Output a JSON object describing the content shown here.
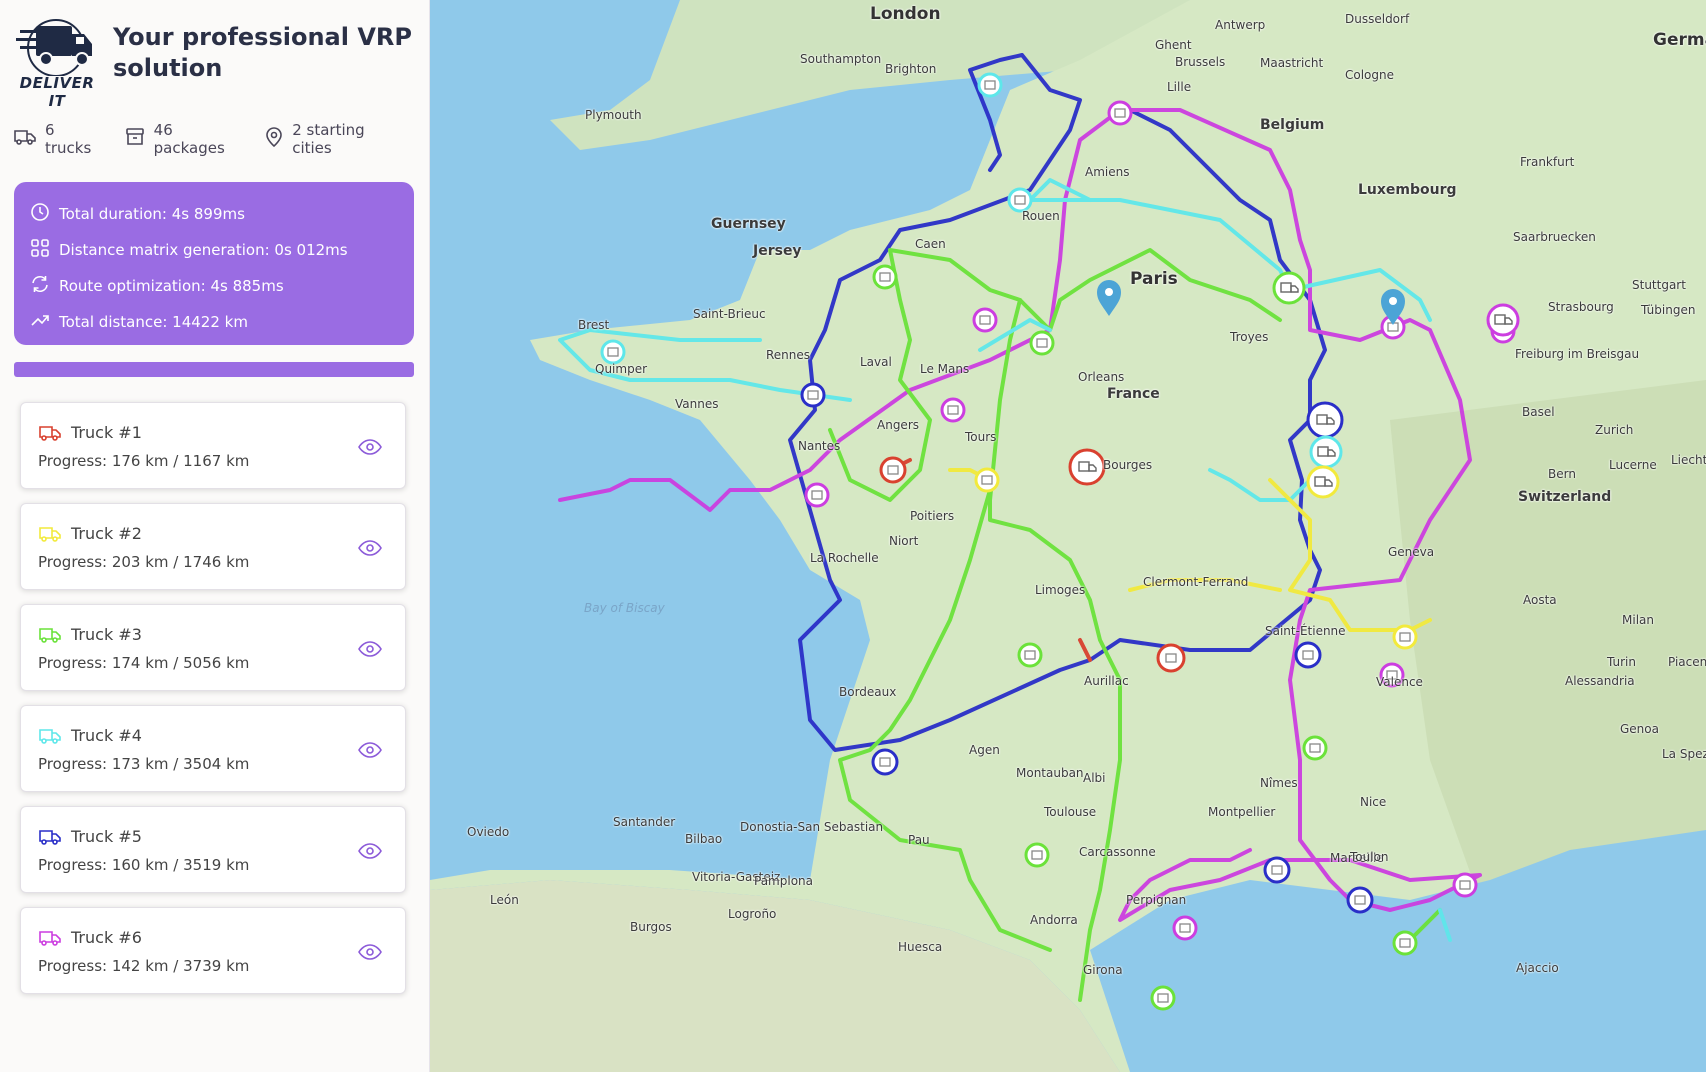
{
  "app": {
    "logo_text": "DELIVER IT",
    "tagline": "Your professional VRP solution"
  },
  "summary": {
    "trucks": "6 trucks",
    "packages": "46 packages",
    "starting_cities": "2 starting cities"
  },
  "metrics": {
    "total_duration": "Total duration: 4s 899ms",
    "matrix_generation": "Distance matrix generation: 0s 012ms",
    "route_optimization": "Route optimization: 4s 885ms",
    "total_distance": "Total distance: 14422 km"
  },
  "colors": {
    "accent": "#9a6ce3",
    "truck_1": "#d9412f",
    "truck_2": "#f2ea3c",
    "truck_3": "#6be23a",
    "truck_4": "#5ee7ea",
    "truck_5": "#2a2fc8",
    "truck_6": "#cc3ee0"
  },
  "trucks": [
    {
      "name": "Truck #1",
      "progress": "Progress: 176 km / 1167 km",
      "icon": "truck-icon",
      "color": "#d9412f"
    },
    {
      "name": "Truck #2",
      "progress": "Progress: 203 km / 1746 km",
      "icon": "truck-icon",
      "color": "#f2ea3c"
    },
    {
      "name": "Truck #3",
      "progress": "Progress: 174 km / 5056 km",
      "icon": "truck-icon",
      "color": "#6be23a"
    },
    {
      "name": "Truck #4",
      "progress": "Progress: 173 km / 3504 km",
      "icon": "truck-icon",
      "color": "#5ee7ea"
    },
    {
      "name": "Truck #5",
      "progress": "Progress: 160 km / 3519 km",
      "icon": "truck-icon",
      "color": "#2a2fc8"
    },
    {
      "name": "Truck #6",
      "progress": "Progress: 142 km / 3739 km",
      "icon": "truck-icon",
      "color": "#cc3ee0"
    }
  ],
  "map": {
    "places": [
      "London",
      "Southampton",
      "Brighton",
      "Plymouth",
      "Antwerp",
      "Ghent",
      "Brussels",
      "Maastricht",
      "Dusseldorf",
      "Cologne",
      "Germa",
      "Lille",
      "Belgium",
      "Amiens",
      "Frankfurt",
      "Luxembourg",
      "Guernsey",
      "Jersey",
      "Rouen",
      "Caen",
      "Saarbruecken",
      "Paris",
      "Stuttgart",
      "Tübingen",
      "Strasbourg",
      "Saint-Brieuc",
      "Brest",
      "Rennes",
      "Laval",
      "Le Mans",
      "Troyes",
      "Quimper",
      "Vannes",
      "Orleans",
      "France",
      "Freiburg im Breisgau",
      "Basel",
      "Zurich",
      "Angers",
      "Tours",
      "Nantes",
      "Bourges",
      "Lucerne",
      "Liechtenstein",
      "Bern",
      "Switzerland",
      "Poitiers",
      "Niort",
      "La Rochelle",
      "Geneva",
      "Bay of Biscay",
      "Limoges",
      "Clermont-Ferrand",
      "Aosta",
      "Milan",
      "Saint-Étienne",
      "Turin",
      "Piacenza",
      "Alessandria",
      "Valence",
      "Aurillac",
      "Bordeaux",
      "Genoa",
      "La Spezi",
      "Agen",
      "Montauban",
      "Albi",
      "Nîmes",
      "Nice",
      "Montpellier",
      "Toulouse",
      "Oviedo",
      "Santander",
      "Donostia-San Sebastian",
      "Bilbao",
      "Pau",
      "Carcassonne",
      "Marseille",
      "Toulon",
      "Vitoria-Gasteiz",
      "Pamplona",
      "León",
      "Logroño",
      "Perpignan",
      "Burgos",
      "Andorra",
      "Huesca",
      "Girona",
      "Ajaccio"
    ]
  }
}
